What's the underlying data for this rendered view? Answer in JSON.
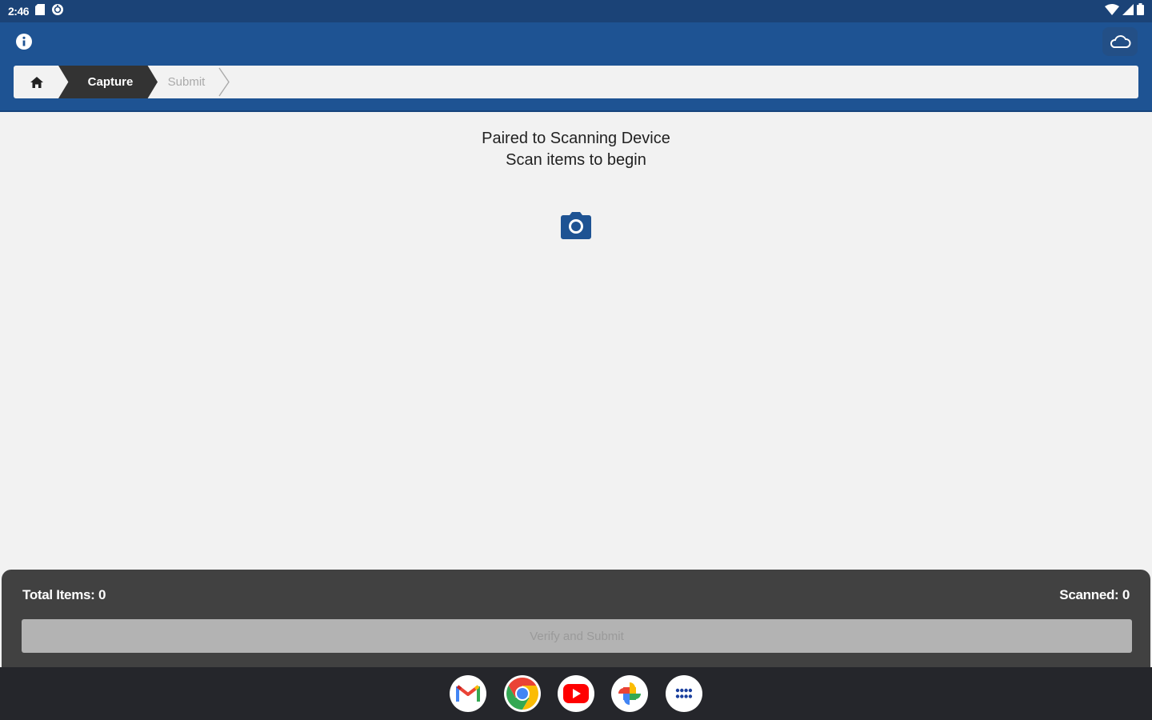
{
  "status_bar": {
    "time": "2:46"
  },
  "breadcrumb": {
    "home_icon": "home-icon",
    "steps": [
      {
        "label": "Capture",
        "active": true
      },
      {
        "label": "Submit",
        "active": false
      }
    ]
  },
  "main": {
    "message_line1": "Paired to Scanning Device",
    "message_line2": "Scan items to begin",
    "camera_icon": "camera-icon"
  },
  "footer": {
    "total_items": "Total Items: 0",
    "scanned": "Scanned: 0",
    "submit_label": "Verify and Submit"
  },
  "dock": {
    "apps": [
      "gmail",
      "chrome",
      "youtube",
      "photos",
      "app-drawer"
    ]
  },
  "colors": {
    "status_bar": "#1b4377",
    "app_bar": "#1e5393",
    "active_crumb": "#333333",
    "accent": "#1e5393",
    "panel": "#414141",
    "taskbar": "#25262b"
  }
}
